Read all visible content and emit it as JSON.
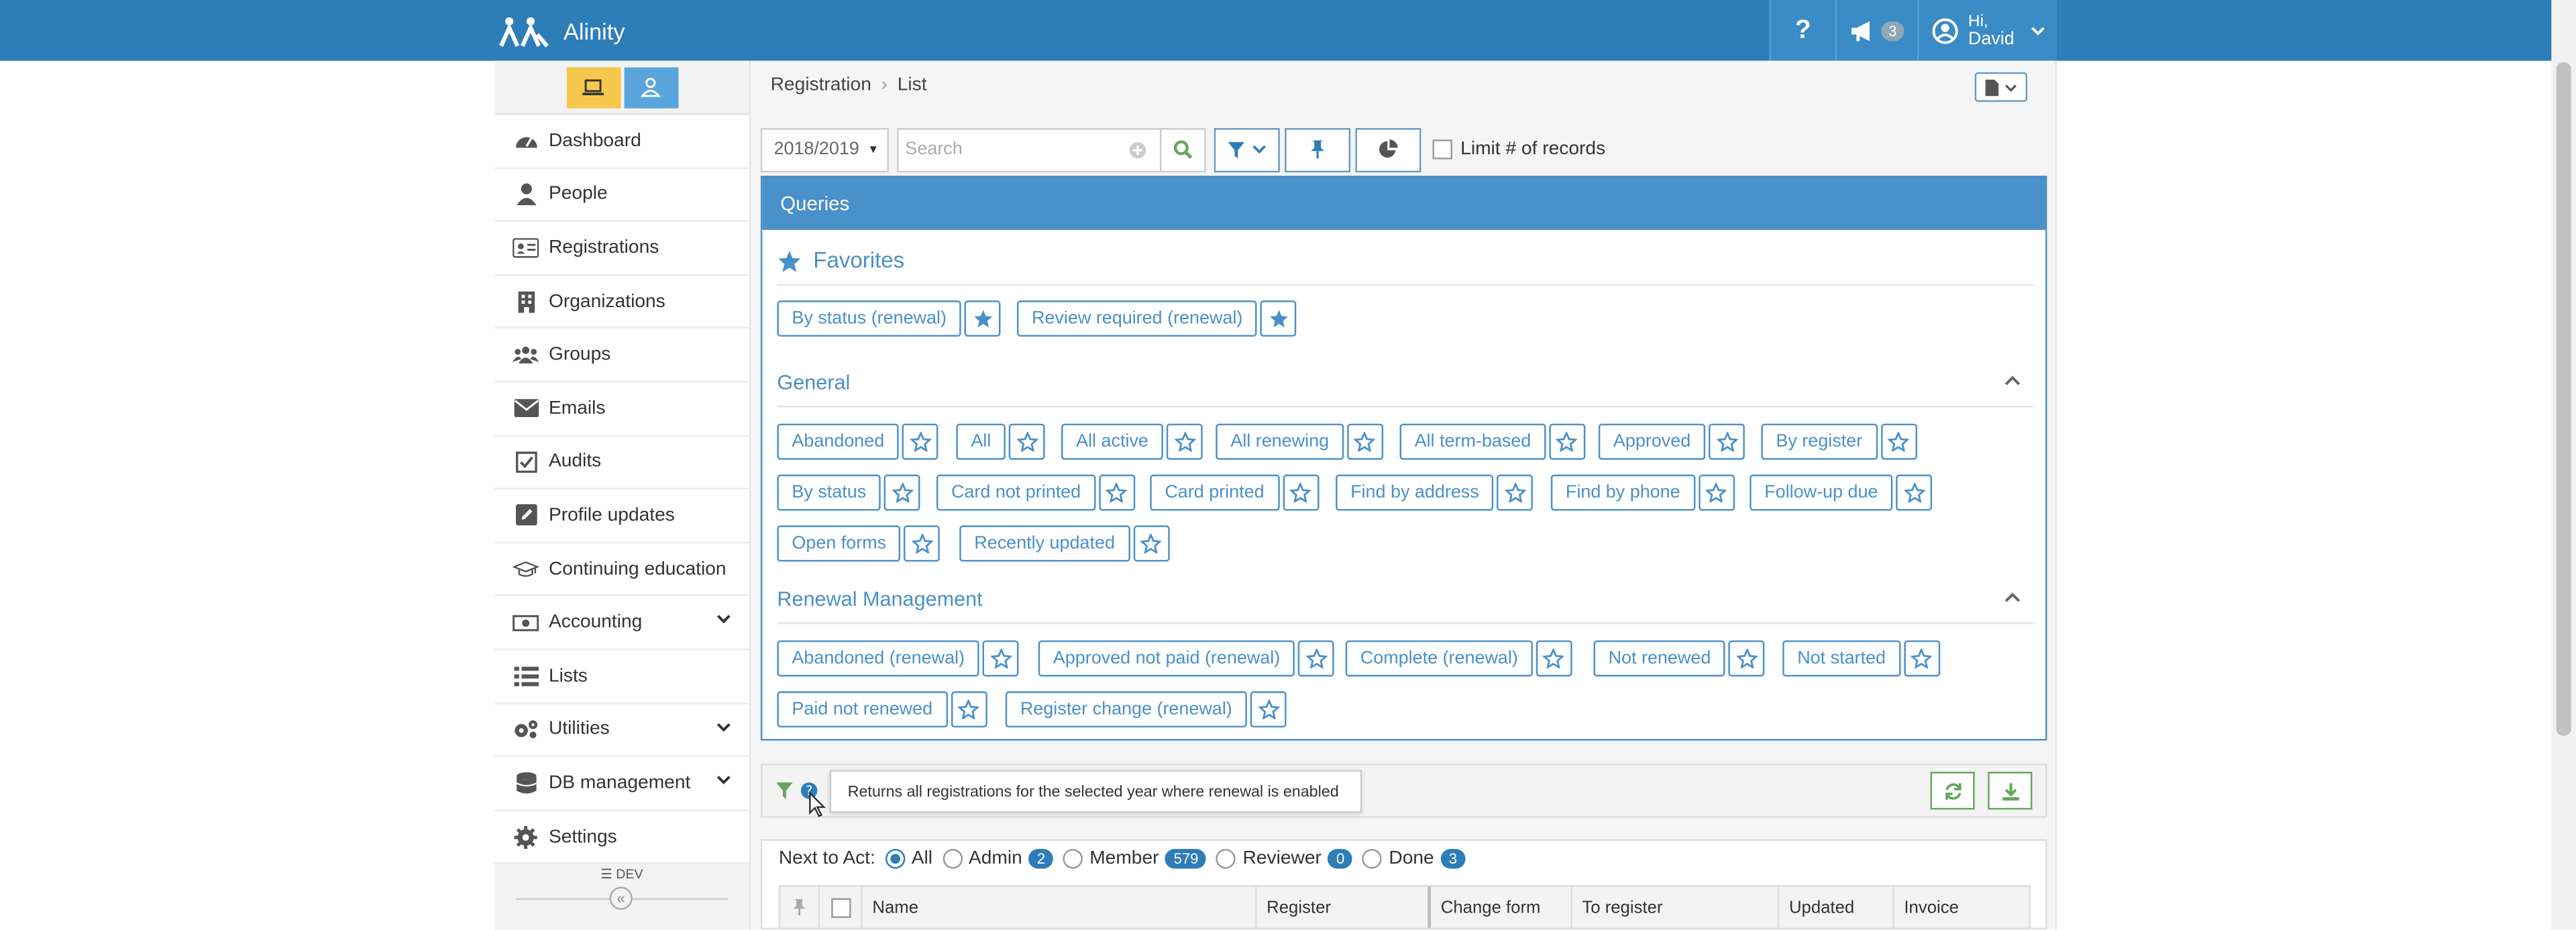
{
  "app": {
    "name": "Alinity"
  },
  "topbar": {
    "help": "?",
    "notifications_count": "3",
    "user_greeting": "Hi,",
    "user_name": "David"
  },
  "breadcrumb": {
    "root": "Registration",
    "sep": "›",
    "current": "List"
  },
  "sidebar": {
    "items": [
      {
        "label": "Dashboard",
        "icon": "dashboard-icon"
      },
      {
        "label": "People",
        "icon": "person-icon"
      },
      {
        "label": "Registrations",
        "icon": "id-card-icon"
      },
      {
        "label": "Organizations",
        "icon": "building-icon"
      },
      {
        "label": "Groups",
        "icon": "users-icon"
      },
      {
        "label": "Emails",
        "icon": "envelope-icon"
      },
      {
        "label": "Audits",
        "icon": "checkbox-icon"
      },
      {
        "label": "Profile updates",
        "icon": "edit-icon"
      },
      {
        "label": "Continuing education",
        "icon": "graduation-cap-icon"
      },
      {
        "label": "Accounting",
        "icon": "money-icon"
      },
      {
        "label": "Lists",
        "icon": "list-icon"
      },
      {
        "label": "Utilities",
        "icon": "gears-icon"
      },
      {
        "label": "DB management",
        "icon": "database-icon"
      },
      {
        "label": "Settings",
        "icon": "gear-icon"
      }
    ],
    "env_label": "DEV",
    "collapse": "«"
  },
  "toolbar": {
    "year": "2018/2019",
    "search_placeholder": "Search",
    "limit_label": "Limit # of records"
  },
  "queries": {
    "title": "Queries",
    "favorites_title": "Favorites",
    "favorites": [
      "By status (renewal)",
      "Review required (renewal)"
    ],
    "general_title": "General",
    "general": [
      "Abandoned",
      "All",
      "All active",
      "All renewing",
      "All term-based",
      "Approved",
      "By register",
      "By status",
      "Card not printed",
      "Card printed",
      "Find by address",
      "Find by phone",
      "Follow-up due",
      "Open forms",
      "Recently updated"
    ],
    "renewal_title": "Renewal Management",
    "renewal": [
      "Abandoned (renewal)",
      "Approved not paid (renewal)",
      "Complete (renewal)",
      "Not renewed",
      "Not started",
      "Paid not renewed",
      "Register change (renewal)"
    ]
  },
  "filter_tooltip": "Returns all registrations for the selected year where renewal is enabled",
  "next_to_act": {
    "label": "Next to Act:",
    "options": [
      {
        "label": "All",
        "count": ""
      },
      {
        "label": "Admin",
        "count": "2"
      },
      {
        "label": "Member",
        "count": "579"
      },
      {
        "label": "Reviewer",
        "count": "0"
      },
      {
        "label": "Done",
        "count": "3"
      }
    ]
  },
  "table": {
    "columns": [
      "Name",
      "Register",
      "Change form",
      "To register",
      "Updated",
      "Invoice"
    ]
  },
  "colors": {
    "brand": "#2d7db8",
    "accent": "#4a90c9",
    "desk_mode": "#f5c84c",
    "green": "#66a55e"
  }
}
